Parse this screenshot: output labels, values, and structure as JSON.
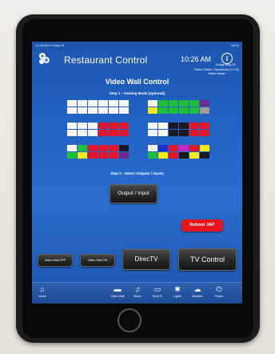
{
  "status_bar": {
    "left": "10:28 AM  Fri May 31",
    "right": "100%"
  },
  "header": {
    "title": "Restaurant Control",
    "time": "10:26 AM",
    "info_glyph": "i",
    "date": "Friday May 31",
    "switch_status": "Switch Status: Operational (3 x 13) Switch Model"
  },
  "video_wall": {
    "title": "Video Wall Control",
    "step1": "Step 1 - Viewing Mode (optional)",
    "step2": "Step 2 - Select Outputs / Inputs"
  },
  "colors": {
    "white": "#f6f6f6",
    "red": "#e3152a",
    "green": "#1fbf3b",
    "yellow": "#f4ea16",
    "dark": "#171820",
    "purple": "#6a2a8e",
    "blue": "#1d2fc9",
    "magenta": "#c525c2",
    "gray": "#9a9a9a",
    "accent_red": "#e8141b"
  },
  "presets": [
    {
      "name": "preset-all-white",
      "rows": [
        [
          "white",
          "white",
          "white",
          "white",
          "white",
          "white"
        ],
        [
          "white",
          "white",
          "white",
          "white",
          "white",
          "white"
        ]
      ]
    },
    {
      "name": "preset-green-wall",
      "rows": [
        [
          "white",
          "green",
          "green",
          "green",
          "green",
          "purple"
        ],
        [
          "yellow",
          "green",
          "green",
          "green",
          "green",
          "gray"
        ]
      ]
    },
    {
      "name": "preset-white-red",
      "rows": [
        [
          "white",
          "white",
          "white",
          "red",
          "red",
          "red"
        ],
        [
          "white",
          "white",
          "white",
          "red",
          "red",
          "red"
        ]
      ]
    },
    {
      "name": "preset-white-dark-red",
      "rows": [
        [
          "white",
          "white",
          "dark",
          "dark",
          "red",
          "red"
        ],
        [
          "white",
          "white",
          "dark",
          "dark",
          "red",
          "red"
        ]
      ]
    },
    {
      "name": "preset-mixed-colors",
      "rows": [
        [
          "white",
          "green",
          "red",
          "red",
          "red",
          "dark"
        ],
        [
          "green",
          "yellow",
          "red",
          "red",
          "red",
          "purple"
        ]
      ]
    },
    {
      "name": "preset-multi-color",
      "rows": [
        [
          "white",
          "blue",
          "red",
          "magenta",
          "red",
          "yellow"
        ],
        [
          "green",
          "yellow",
          "red",
          "dark",
          "yellow",
          "dark"
        ]
      ]
    }
  ],
  "buttons": {
    "output_input": "Output / Input",
    "reboot": "Reboot JAP",
    "video_wall_off": "Video Wall OFF",
    "video_wall_on": "Video Wall ON",
    "directv": "DirecTV",
    "tv_control": "TV Control"
  },
  "nav": [
    {
      "label": "Home",
      "icon": "home-icon",
      "glyph": "⌂"
    },
    {
      "label": "Video Wall",
      "icon": "tv-icon",
      "glyph": "▬"
    },
    {
      "label": "Music",
      "icon": "music-icon",
      "glyph": "♫"
    },
    {
      "label": "DirecTv",
      "icon": "satellite-tv-icon",
      "glyph": "▭"
    },
    {
      "label": "Lights",
      "icon": "lightbulb-icon",
      "glyph": "✱"
    },
    {
      "label": "Weather",
      "icon": "cloud-icon",
      "glyph": "☁"
    },
    {
      "label": "Power",
      "icon": "power-icon",
      "glyph": "⏻"
    }
  ]
}
